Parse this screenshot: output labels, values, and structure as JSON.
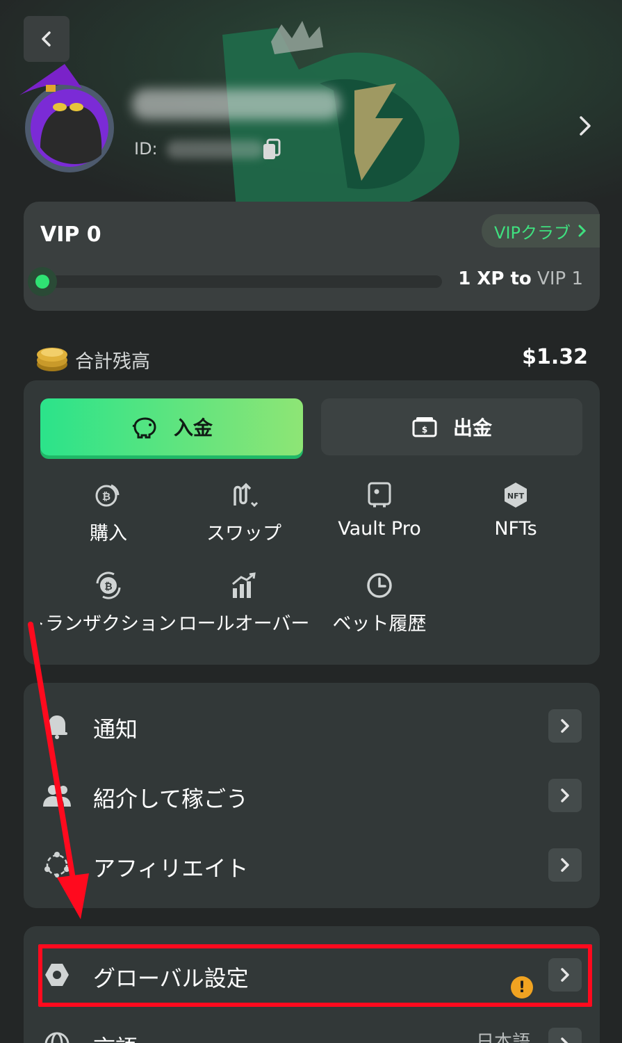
{
  "header": {
    "back_icon": "chevron-left-icon",
    "id_label": "ID:",
    "profile_chevron_icon": "chevron-right-icon"
  },
  "vip": {
    "level": "VIP 0",
    "club_label": "VIPクラブ",
    "progress_fraction": 0.0,
    "next_xp": "1 XP to",
    "next_level": "VIP 1",
    "accent_color": "#3fe07f"
  },
  "balance": {
    "label": "合計残高",
    "value": "$1.32"
  },
  "wallet": {
    "deposit_label": "入金",
    "withdraw_label": "出金",
    "deposit_colors": [
      "#2be38a",
      "#8ee575"
    ],
    "actions": [
      {
        "label": "購入",
        "icon": "bitcoin-coin-icon"
      },
      {
        "label": "スワップ",
        "icon": "swap-arrows-icon"
      },
      {
        "label": "Vault Pro",
        "icon": "vault-icon"
      },
      {
        "label": "NFTs",
        "icon": "nft-icon"
      },
      {
        "label": "トランザクション",
        "icon": "bitcoin-cycle-icon"
      },
      {
        "label": "ロールオーバー",
        "icon": "rollover-chart-icon"
      },
      {
        "label": "ベット履歴",
        "icon": "clock-icon"
      }
    ]
  },
  "menu": {
    "items": [
      {
        "label": "通知",
        "icon": "bell-icon"
      },
      {
        "label": "紹介して稼ごう",
        "icon": "users-icon"
      },
      {
        "label": "アフィリエイト",
        "icon": "network-icon"
      }
    ]
  },
  "settings": {
    "global_label": "グローバル設定",
    "global_warning": "!",
    "language_label": "言語",
    "language_value": "日本語"
  },
  "annotation": {
    "highlight_color": "#ff0a1e"
  }
}
